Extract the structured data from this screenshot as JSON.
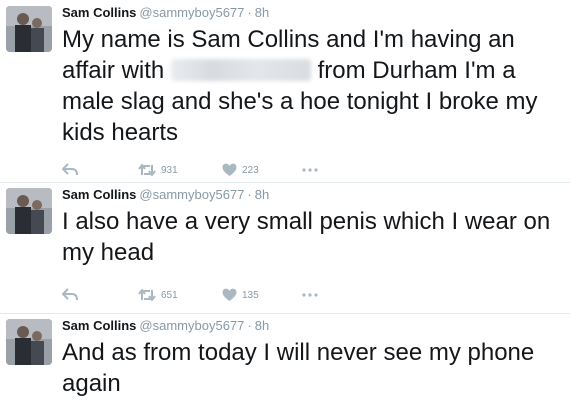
{
  "tweets": [
    {
      "name": "Sam Collins",
      "handle": "@sammyboy5677",
      "separator": "·",
      "time": "8h",
      "text_part1": "My name is Sam Collins and I'm having an affair with ",
      "text_part2": " from Durham I'm a male slag and she's a hoe tonight I broke my kids hearts",
      "retweets": "931",
      "likes": "223"
    },
    {
      "name": "Sam Collins",
      "handle": "@sammyboy5677",
      "separator": "·",
      "time": "8h",
      "text": "I also have a very small penis which I wear on my head",
      "retweets": "651",
      "likes": "135"
    },
    {
      "name": "Sam Collins",
      "handle": "@sammyboy5677",
      "separator": "·",
      "time": "8h",
      "text": "And as from today I will never see my phone again"
    }
  ],
  "colors": {
    "text": "#14171a",
    "muted": "#8899a6",
    "icon": "#aab8c2",
    "divider": "#e1e8ed"
  },
  "icons": [
    "reply-icon",
    "retweet-icon",
    "heart-icon",
    "more-icon"
  ]
}
